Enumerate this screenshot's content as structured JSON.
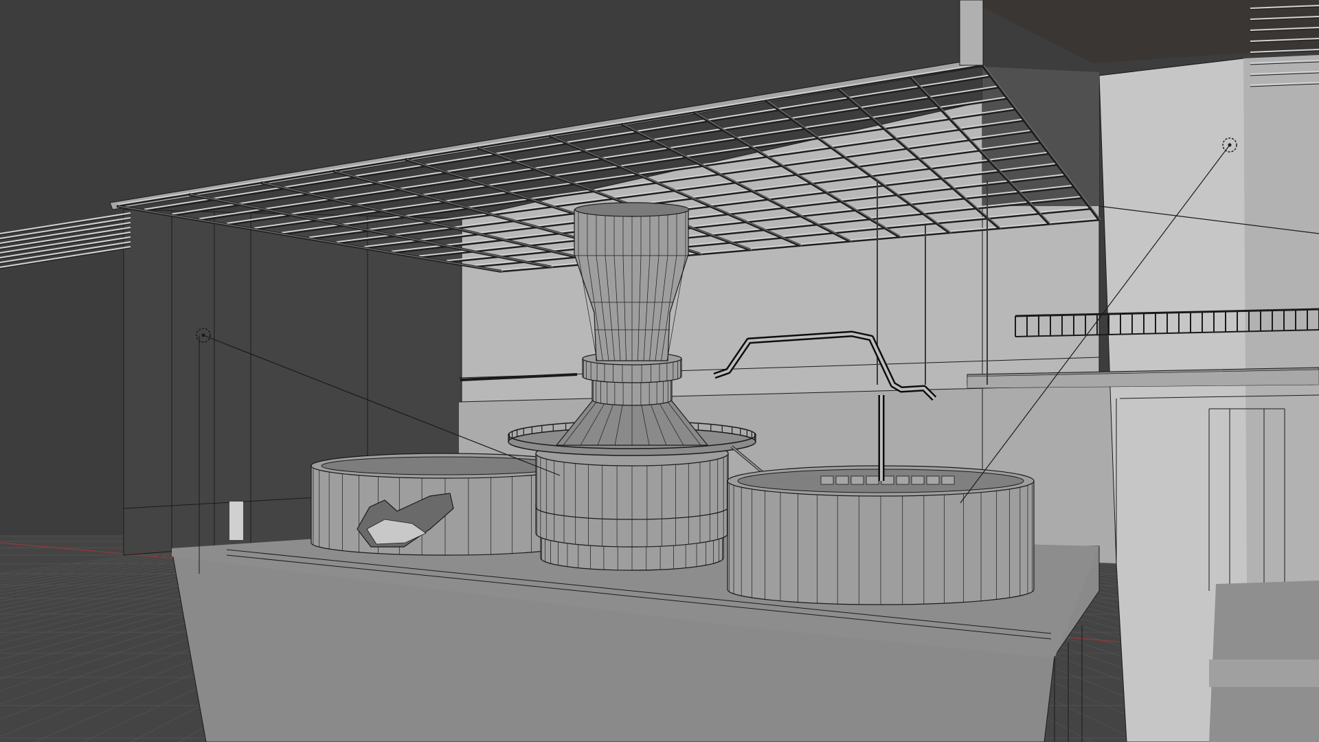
{
  "viewport": {
    "shading": "solid",
    "wireframe_overlay": true,
    "show_floor_grid": true,
    "colors": {
      "background": "#3d3d3d",
      "floor": "#444444",
      "grid_line": "#505050",
      "wall_light": "#b8b8b8",
      "wall_lighter": "#c6c6c6",
      "wall_dark": "#444444",
      "wall_mid": "#8a8a8a",
      "slab_edge": "#a6a6a6",
      "grate_bar": "#d2d2d2",
      "grate_dark": "#1e1e1e",
      "tank": "#9e9e9e",
      "tank_shadow": "#6a6a6a",
      "edge": "#1a1a1a",
      "x_axis": "#8a3a3a",
      "y_axis": "#6e8a3a",
      "origin": "#ffb000"
    }
  },
  "scene": {
    "objects": [
      {
        "name": "ceiling-grate",
        "type": "mesh"
      },
      {
        "name": "distillation-column",
        "type": "mesh"
      },
      {
        "name": "vessel-left",
        "type": "mesh"
      },
      {
        "name": "vessel-right",
        "type": "mesh"
      },
      {
        "name": "platform",
        "type": "mesh"
      },
      {
        "name": "walkway-railing",
        "type": "mesh"
      },
      {
        "name": "pipe",
        "type": "curve"
      }
    ],
    "lights": [
      {
        "name": "area-light-left",
        "type": "light"
      },
      {
        "name": "area-light-right",
        "type": "light"
      }
    ]
  }
}
